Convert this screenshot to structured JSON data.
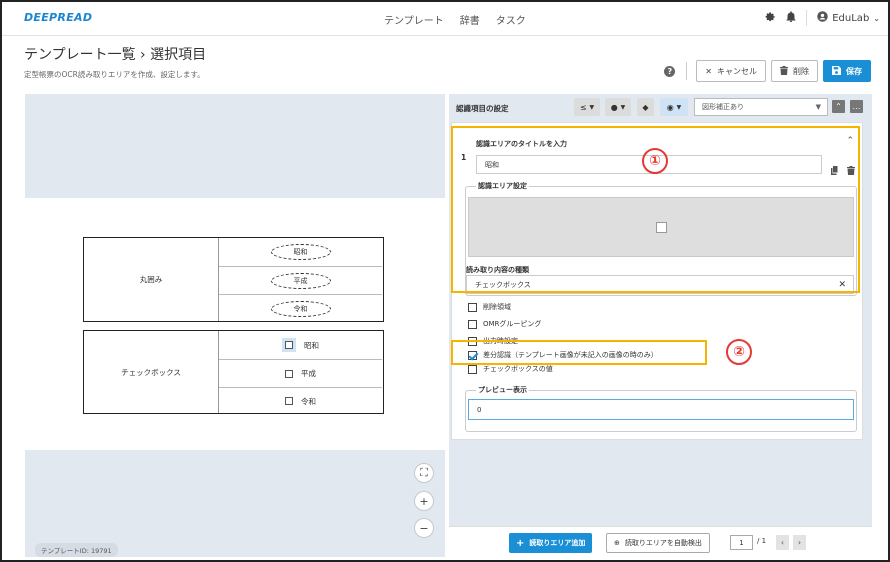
{
  "app": {
    "logo": "DEEPREAD",
    "nav": [
      "テンプレート",
      "辞書",
      "タスク"
    ],
    "user": "EduLab"
  },
  "header": {
    "title": "テンプレート一覧 › 選択項目",
    "subtitle": "定型帳票のOCR読み取りエリアを作成、設定します。",
    "help": "?",
    "cancel_label": "キャンセル",
    "delete_label": "削除",
    "save_label": "保存"
  },
  "canvas": {
    "table1": {
      "label": "丸囲み",
      "options": [
        "昭和",
        "平成",
        "令和"
      ]
    },
    "table2": {
      "label": "チェックボックス",
      "options": [
        "昭和",
        "平成",
        "令和"
      ]
    },
    "template_id": "テンプレートID: 19791",
    "zoom_fit": "⛶",
    "zoom_in": "+",
    "zoom_out": "−"
  },
  "panel": {
    "title": "認識項目の設定",
    "tool1": "≤",
    "tool2": "●",
    "tool3": "◆",
    "tool4": "◉",
    "correction_select": "図形補正あり",
    "item_number": "1",
    "title_label": "認識エリアのタイトルを入力",
    "title_value": "昭和",
    "area_label": "認識エリア設定",
    "content_type_label": "読み取り内容の種類",
    "content_type_value": "チェックボックス",
    "options": [
      {
        "label": "削除領域",
        "checked": false
      },
      {
        "label": "OMRグルーピング",
        "checked": false
      },
      {
        "label": "出力時設定",
        "checked": false
      },
      {
        "label": "差分認識（テンプレート画像が未記入の画像の時のみ）",
        "checked": true
      },
      {
        "label": "チェックボックスの値",
        "checked": false
      }
    ],
    "preview_label": "プレビュー表示",
    "preview_value": "0"
  },
  "bottom": {
    "add_area": "読取りエリア追加",
    "auto_detect": "読取りエリアを自動検出",
    "page_current": "1",
    "page_total": "/ 1"
  },
  "annotations": [
    "①",
    "②"
  ],
  "colors": {
    "accent": "#1a8fd6",
    "highlight": "#f5b400",
    "annotation": "#e53935"
  }
}
